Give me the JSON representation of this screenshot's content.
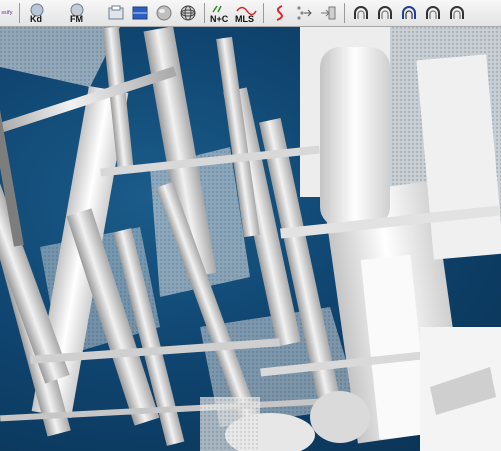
{
  "toolbar": {
    "left_fragment_label": "ssify",
    "kd_label": "Kd",
    "fm_label": "FM",
    "normals_label": "N+C",
    "mls_label": "MLS"
  },
  "colors": {
    "viewport_bg": "#0f4570",
    "structure_fill": "#e6e6e6",
    "accent_red": "#d9262b"
  }
}
